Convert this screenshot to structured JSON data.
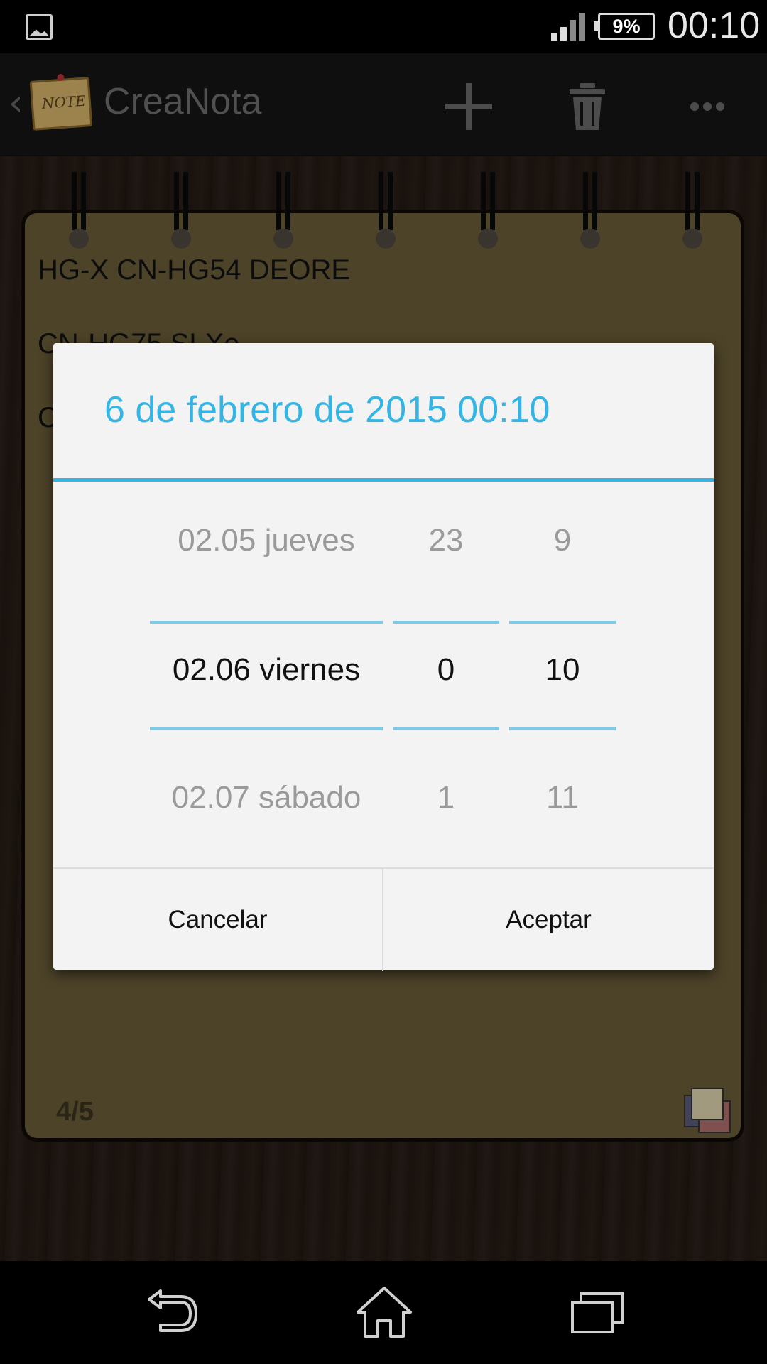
{
  "status_bar": {
    "battery": "9%",
    "time": "00:10"
  },
  "action_bar": {
    "title": "CreaNota",
    "logo_text": "NOTE"
  },
  "note": {
    "lines": [
      "HG-X CN-HG54 DEORE",
      "CN-HG75 SLXe",
      "C"
    ],
    "page_counter": "4/5"
  },
  "dialog": {
    "title": "6 de febrero de 2015 00:10",
    "date_column": {
      "prev": "02.05 jueves",
      "current": "02.06 viernes",
      "next": "02.07 sábado"
    },
    "hour_column": {
      "prev": "23",
      "current": "0",
      "next": "1"
    },
    "minute_column": {
      "prev": "9",
      "current": "10",
      "next": "11"
    },
    "cancel_label": "Cancelar",
    "accept_label": "Aceptar"
  },
  "colors": {
    "accent": "#33b5e5",
    "notebook": "#6a5e38"
  }
}
